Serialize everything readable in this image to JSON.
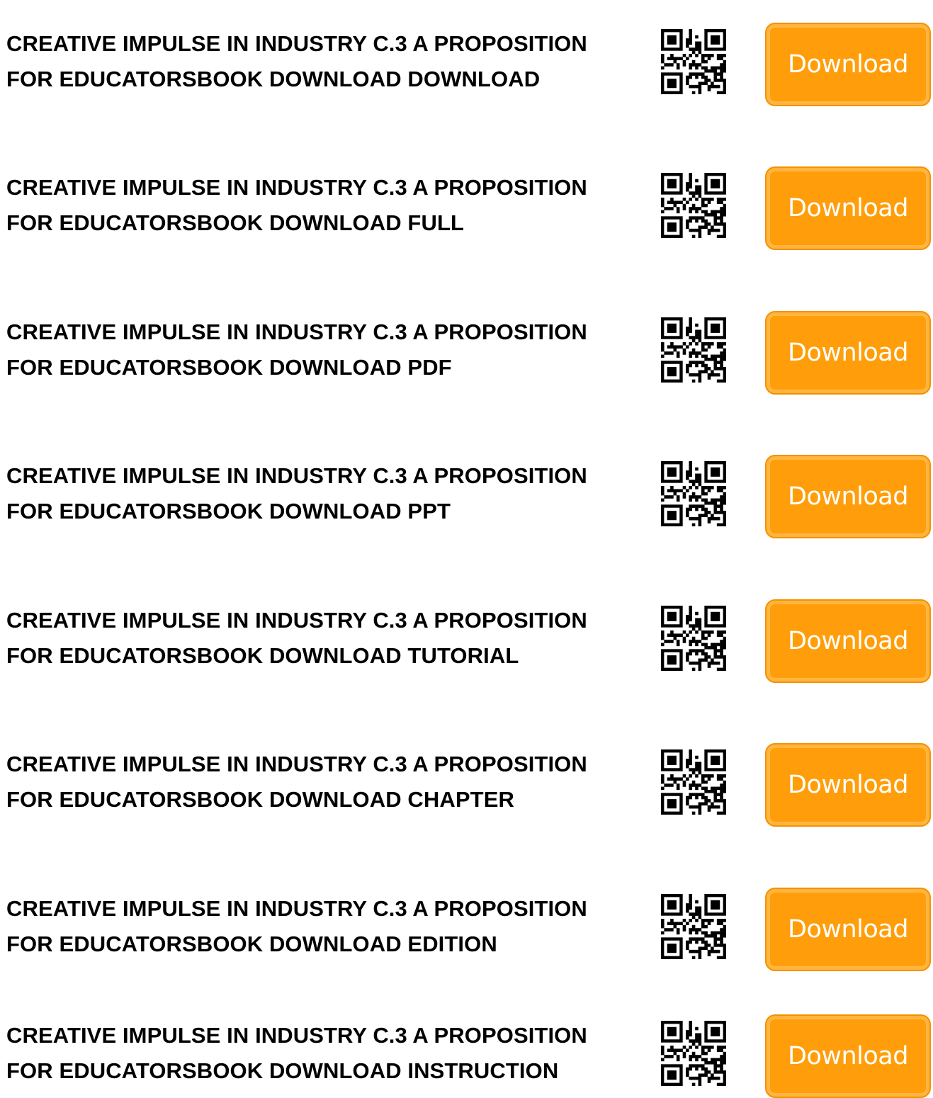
{
  "colors": {
    "button_fill": "#ff9e0a",
    "button_text": "#ffffff",
    "title_text": "#000000"
  },
  "items": [
    {
      "title": "CREATIVE IMPULSE IN INDUSTRY C.3 A PROPOSITION\nFOR EDUCATORSBOOK DOWNLOAD DOWNLOAD",
      "button_label": "Download",
      "qr_icon": "qr-code-icon"
    },
    {
      "title": "CREATIVE IMPULSE IN INDUSTRY C.3 A PROPOSITION\nFOR EDUCATORSBOOK DOWNLOAD FULL",
      "button_label": "Download",
      "qr_icon": "qr-code-icon"
    },
    {
      "title": "CREATIVE IMPULSE IN INDUSTRY C.3 A PROPOSITION\nFOR EDUCATORSBOOK DOWNLOAD PDF",
      "button_label": "Download",
      "qr_icon": "qr-code-icon"
    },
    {
      "title": "CREATIVE IMPULSE IN INDUSTRY C.3 A PROPOSITION\nFOR EDUCATORSBOOK DOWNLOAD PPT",
      "button_label": "Download",
      "qr_icon": "qr-code-icon"
    },
    {
      "title": "CREATIVE IMPULSE IN INDUSTRY C.3 A PROPOSITION\nFOR EDUCATORSBOOK DOWNLOAD TUTORIAL",
      "button_label": "Download",
      "qr_icon": "qr-code-icon"
    },
    {
      "title": "CREATIVE IMPULSE IN INDUSTRY C.3 A PROPOSITION\nFOR EDUCATORSBOOK DOWNLOAD CHAPTER",
      "button_label": "Download",
      "qr_icon": "qr-code-icon"
    },
    {
      "title": "CREATIVE IMPULSE IN INDUSTRY C.3 A PROPOSITION\nFOR EDUCATORSBOOK DOWNLOAD EDITION",
      "button_label": "Download",
      "qr_icon": "qr-code-icon"
    },
    {
      "title": "CREATIVE IMPULSE IN INDUSTRY C.3 A PROPOSITION\nFOR EDUCATORSBOOK DOWNLOAD INSTRUCTION",
      "button_label": "Download",
      "qr_icon": "qr-code-icon"
    }
  ]
}
